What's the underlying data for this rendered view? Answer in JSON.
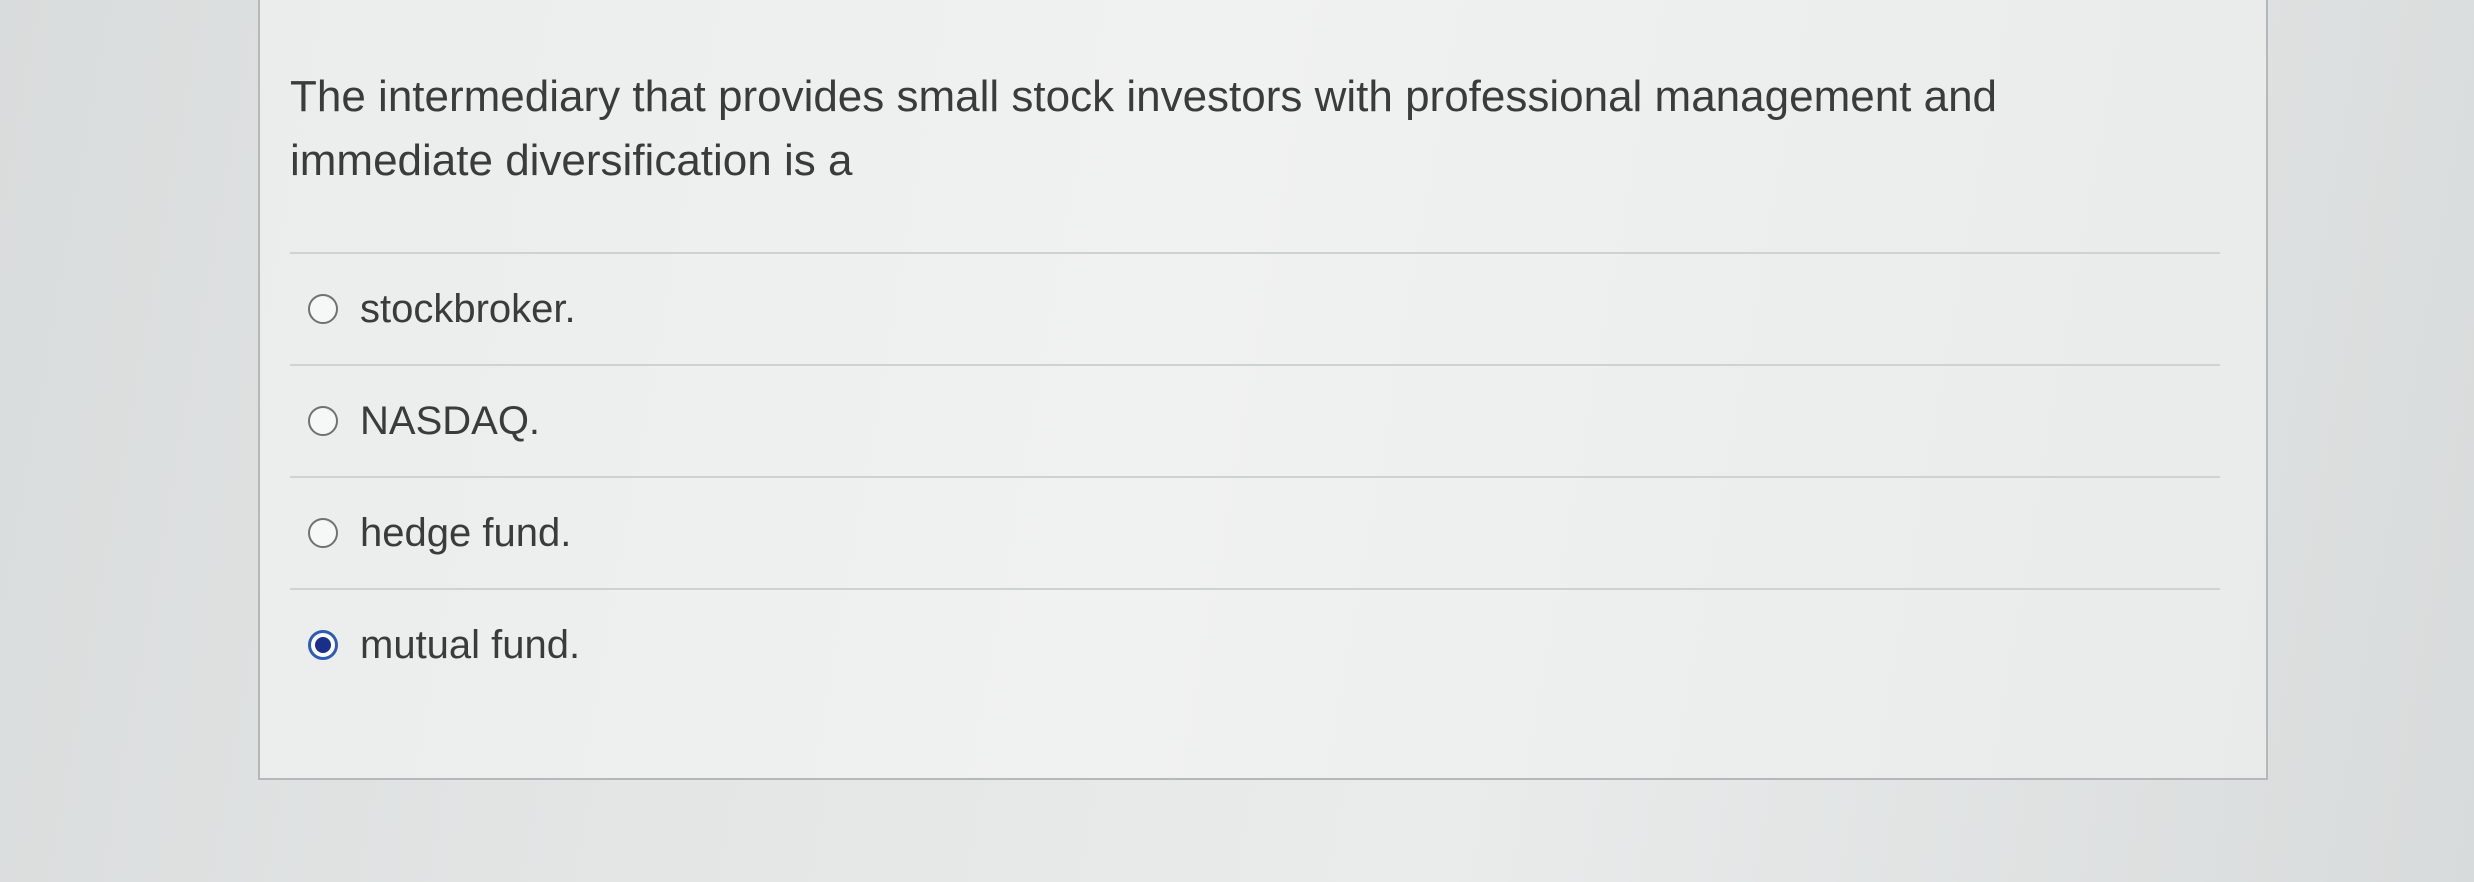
{
  "question": {
    "text": "The intermediary that provides small stock investors with professional management and immediate diversification is a"
  },
  "options": [
    {
      "label": "stockbroker.",
      "selected": false
    },
    {
      "label": "NASDAQ.",
      "selected": false
    },
    {
      "label": "hedge fund.",
      "selected": false
    },
    {
      "label": "mutual fund.",
      "selected": true
    }
  ],
  "colors": {
    "selected_radio": "#2e5bb5",
    "text": "#3a3c3c"
  }
}
